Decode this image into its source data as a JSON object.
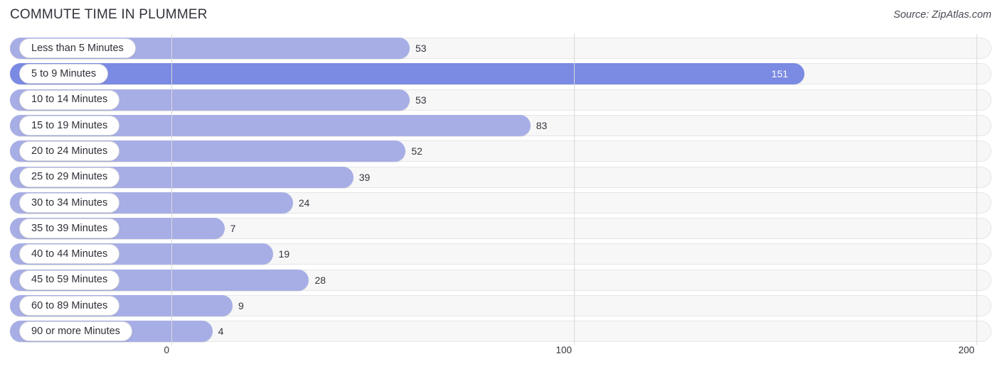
{
  "header": {
    "title": "COMMUTE TIME IN PLUMMER",
    "source": "Source: ZipAtlas.com"
  },
  "axis": {
    "ticks": [
      "0",
      "100",
      "200"
    ]
  },
  "chart_data": {
    "type": "bar",
    "orientation": "horizontal",
    "title": "COMMUTE TIME IN PLUMMER",
    "subtitle": "Source: ZipAtlas.com",
    "xlabel": "",
    "ylabel": "",
    "xlim": [
      0,
      200
    ],
    "xticks": [
      0,
      100,
      200
    ],
    "grid": true,
    "legend": null,
    "highlight_index": 1,
    "colors": {
      "bar": "#a7aee5",
      "bar_highlight": "#7b8ae2",
      "track": "#f7f7f8",
      "track_border": "#e6e6e9",
      "pill_background": "#ffffff",
      "pill_border": "#d9d9de",
      "value_text": "#33333c",
      "value_text_inside": "#ffffff",
      "gridline": "#d8d8dc"
    },
    "categories": [
      "Less than 5 Minutes",
      "5 to 9 Minutes",
      "10 to 14 Minutes",
      "15 to 19 Minutes",
      "20 to 24 Minutes",
      "25 to 29 Minutes",
      "30 to 34 Minutes",
      "35 to 39 Minutes",
      "40 to 44 Minutes",
      "45 to 59 Minutes",
      "60 to 89 Minutes",
      "90 or more Minutes"
    ],
    "values": [
      53,
      151,
      53,
      83,
      52,
      39,
      24,
      7,
      19,
      28,
      9,
      4
    ],
    "value_labels": [
      "53",
      "151",
      "53",
      "83",
      "52",
      "39",
      "24",
      "7",
      "19",
      "28",
      "9",
      "4"
    ]
  }
}
